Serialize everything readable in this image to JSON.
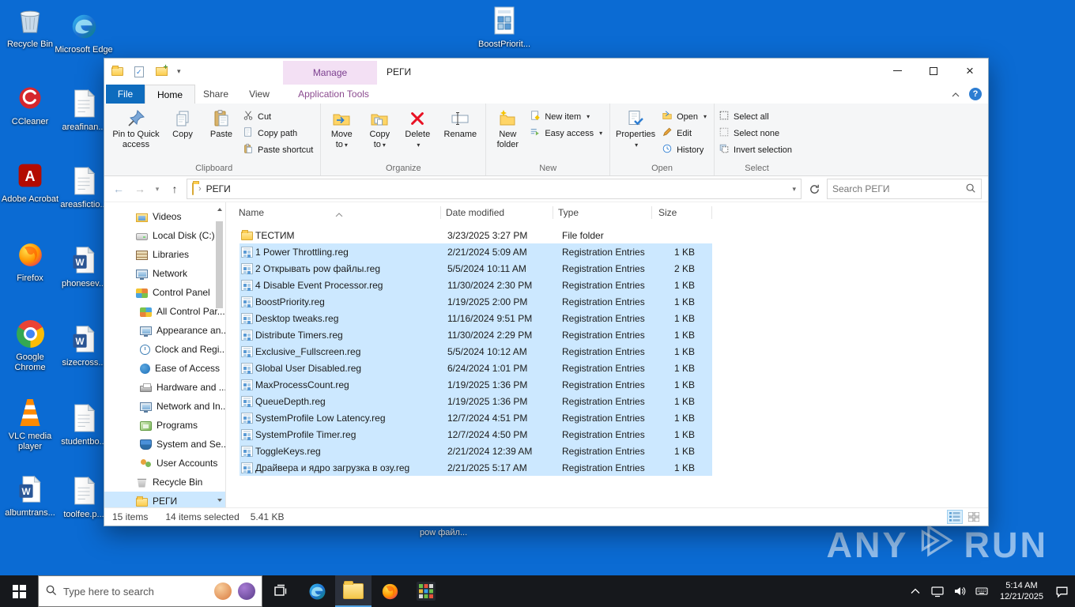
{
  "colors": {
    "accent": "#0078d7",
    "selection": "#cce8ff",
    "contextual_purple": "#8b4a8f",
    "desktop_blue": "#0b6bd3"
  },
  "desktop": {
    "icons": [
      {
        "label": "Recycle Bin",
        "icon": "recycle-bin"
      },
      {
        "label": "Microsoft Edge",
        "icon": "edge"
      },
      {
        "label": "CCleaner",
        "icon": "ccleaner"
      },
      {
        "label": "areafinan...",
        "icon": "document"
      },
      {
        "label": "Adobe Acrobat",
        "icon": "acrobat"
      },
      {
        "label": "areasfictio...",
        "icon": "document"
      },
      {
        "label": "Firefox",
        "icon": "firefox"
      },
      {
        "label": "phonesev...",
        "icon": "word-document"
      },
      {
        "label": "Google Chrome",
        "icon": "chrome"
      },
      {
        "label": "sizecross...",
        "icon": "word-document"
      },
      {
        "label": "VLC media player",
        "icon": "vlc"
      },
      {
        "label": "studentbo...",
        "icon": "document"
      },
      {
        "label": "albumtrans...",
        "icon": "word-document"
      },
      {
        "label": "toolfee.p...",
        "icon": "document"
      },
      {
        "label": "BoostPriorit...",
        "icon": "registry-file"
      }
    ],
    "partial_icon_label": "pow файл..."
  },
  "window": {
    "title": "РЕГИ",
    "contextual_header": "Manage",
    "tabs": {
      "file": "File",
      "home": "Home",
      "share": "Share",
      "view": "View",
      "contextual": "Application Tools"
    },
    "ribbon": {
      "pin": "Pin to Quick access",
      "copy": "Copy",
      "paste": "Paste",
      "cut": "Cut",
      "copy_path": "Copy path",
      "paste_shortcut": "Paste shortcut",
      "move_to": "Move to",
      "copy_to": "Copy to",
      "delete": "Delete",
      "rename": "Rename",
      "new_folder": "New folder",
      "new_item": "New item",
      "easy_access": "Easy access",
      "properties": "Properties",
      "open": "Open",
      "edit": "Edit",
      "history": "History",
      "select_all": "Select all",
      "select_none": "Select none",
      "invert_selection": "Invert selection",
      "groups": {
        "clipboard": "Clipboard",
        "organize": "Organize",
        "new": "New",
        "open": "Open",
        "select": "Select"
      }
    },
    "address": {
      "path": "РЕГИ",
      "search_placeholder": "Search РЕГИ"
    },
    "sidebar": [
      {
        "label": "Videos",
        "icon": "videos"
      },
      {
        "label": "Local Disk (C:)",
        "icon": "disk"
      },
      {
        "label": "Libraries",
        "icon": "libraries"
      },
      {
        "label": "Network",
        "icon": "network"
      },
      {
        "label": "Control Panel",
        "icon": "cpanel"
      },
      {
        "label": "All Control Par...",
        "icon": "cpgrid",
        "indent": true
      },
      {
        "label": "Appearance an...",
        "icon": "monitor",
        "indent": true
      },
      {
        "label": "Clock and Regi...",
        "icon": "clock",
        "indent": true
      },
      {
        "label": "Ease of Access",
        "icon": "ease",
        "indent": true
      },
      {
        "label": "Hardware and ...",
        "icon": "printer",
        "indent": true
      },
      {
        "label": "Network and In...",
        "icon": "monitor",
        "indent": true
      },
      {
        "label": "Programs",
        "icon": "programs",
        "indent": true
      },
      {
        "label": "System and Se...",
        "icon": "system",
        "indent": true
      },
      {
        "label": "User Accounts",
        "icon": "users",
        "indent": true
      },
      {
        "label": "Recycle Bin",
        "icon": "bin"
      },
      {
        "label": "РЕГИ",
        "icon": "folder",
        "selected": true
      }
    ],
    "files": {
      "columns": {
        "name": "Name",
        "date": "Date modified",
        "type": "Type",
        "size": "Size"
      },
      "rows": [
        {
          "name": "ТЕСТИМ",
          "date": "3/23/2025 3:27 PM",
          "type": "File folder",
          "size": "",
          "icon": "folder"
        },
        {
          "name": "1 Power Throttling.reg",
          "date": "2/21/2024 5:09 AM",
          "type": "Registration Entries",
          "size": "1 KB",
          "icon": "reg",
          "selected": true
        },
        {
          "name": "2 Открывать pow файлы.reg",
          "date": "5/5/2024 10:11 AM",
          "type": "Registration Entries",
          "size": "2 KB",
          "icon": "reg",
          "selected": true
        },
        {
          "name": "4 Disable Event Processor.reg",
          "date": "11/30/2024 2:30 PM",
          "type": "Registration Entries",
          "size": "1 KB",
          "icon": "reg",
          "selected": true
        },
        {
          "name": "BoostPriority.reg",
          "date": "1/19/2025 2:00 PM",
          "type": "Registration Entries",
          "size": "1 KB",
          "icon": "reg",
          "selected": true
        },
        {
          "name": "Desktop tweaks.reg",
          "date": "11/16/2024 9:51 PM",
          "type": "Registration Entries",
          "size": "1 KB",
          "icon": "reg",
          "selected": true
        },
        {
          "name": "Distribute Timers.reg",
          "date": "11/30/2024 2:29 PM",
          "type": "Registration Entries",
          "size": "1 KB",
          "icon": "reg",
          "selected": true
        },
        {
          "name": "Exclusive_Fullscreen.reg",
          "date": "5/5/2024 10:12 AM",
          "type": "Registration Entries",
          "size": "1 KB",
          "icon": "reg",
          "selected": true
        },
        {
          "name": "Global User Disabled.reg",
          "date": "6/24/2024 1:01 PM",
          "type": "Registration Entries",
          "size": "1 KB",
          "icon": "reg",
          "selected": true
        },
        {
          "name": "MaxProcessCount.reg",
          "date": "1/19/2025 1:36 PM",
          "type": "Registration Entries",
          "size": "1 KB",
          "icon": "reg",
          "selected": true
        },
        {
          "name": "QueueDepth.reg",
          "date": "1/19/2025 1:36 PM",
          "type": "Registration Entries",
          "size": "1 KB",
          "icon": "reg",
          "selected": true
        },
        {
          "name": "SystemProfile Low Latency.reg",
          "date": "12/7/2024 4:51 PM",
          "type": "Registration Entries",
          "size": "1 KB",
          "icon": "reg",
          "selected": true
        },
        {
          "name": "SystemProfile Timer.reg",
          "date": "12/7/2024 4:50 PM",
          "type": "Registration Entries",
          "size": "1 KB",
          "icon": "reg",
          "selected": true
        },
        {
          "name": "ToggleKeys.reg",
          "date": "2/21/2024 12:39 AM",
          "type": "Registration Entries",
          "size": "1 KB",
          "icon": "reg",
          "selected": true
        },
        {
          "name": "Драйвера и ядро загрузка в озу.reg",
          "date": "2/21/2025 5:17 AM",
          "type": "Registration Entries",
          "size": "1 KB",
          "icon": "reg",
          "selected": true
        }
      ]
    },
    "status": {
      "total": "15 items",
      "selected": "14 items selected",
      "size": "5.41 KB"
    }
  },
  "taskbar": {
    "search_placeholder": "Type here to search",
    "clock": {
      "time": "5:14 AM",
      "date": "12/21/2025"
    }
  },
  "watermark": {
    "left": "ANY",
    "right": "RUN"
  }
}
